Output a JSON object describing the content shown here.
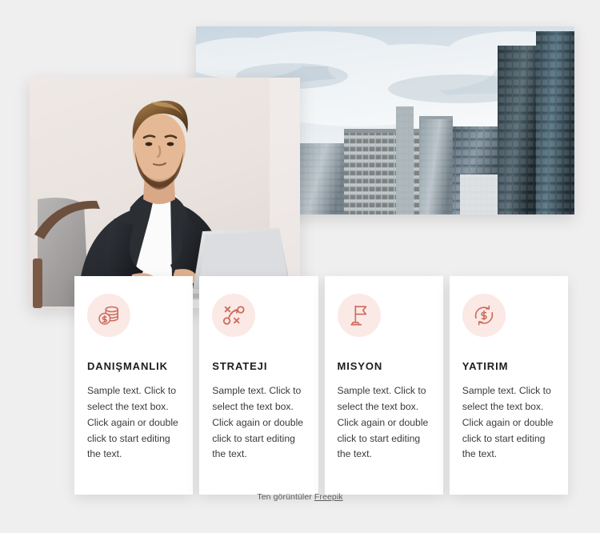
{
  "page": {
    "background_color": "#f0efef"
  },
  "media": {
    "buildings_photo": {
      "name": "city-skyscrapers-photo",
      "alt": "Modern glass office skyscrapers against a cloudy sky"
    },
    "businessman_photo": {
      "name": "businessman-laptop-photo",
      "alt": "Bearded businessman in a dark blazer typing on a laptop"
    }
  },
  "cards": [
    {
      "icon": "coins-stack-icon",
      "title": "DANIŞMANLIK",
      "body": "Sample text. Click to select the text box. Click again or double click to start editing the text."
    },
    {
      "icon": "strategy-tactics-icon",
      "title": "STRATEJI",
      "body": "Sample text. Click to select the text box. Click again or double click to start editing the text."
    },
    {
      "icon": "flag-icon",
      "title": "MISYON",
      "body": "Sample text. Click to select the text box. Click again or double click to start editing the text."
    },
    {
      "icon": "currency-exchange-icon",
      "title": "YATIRIM",
      "body": "Sample text. Click to select the text box. Click again or double click to start editing the text."
    }
  ],
  "credit": {
    "prefix": "Ten görüntüler ",
    "link_label": "Freepik"
  },
  "colors": {
    "accent": "#cd6a5c",
    "icon_circle_bg": "#fbe9e5",
    "card_bg": "#ffffff",
    "title_text": "#1d1d1d",
    "body_text": "#3b3b3b",
    "credit_text": "#5d5d5d"
  }
}
